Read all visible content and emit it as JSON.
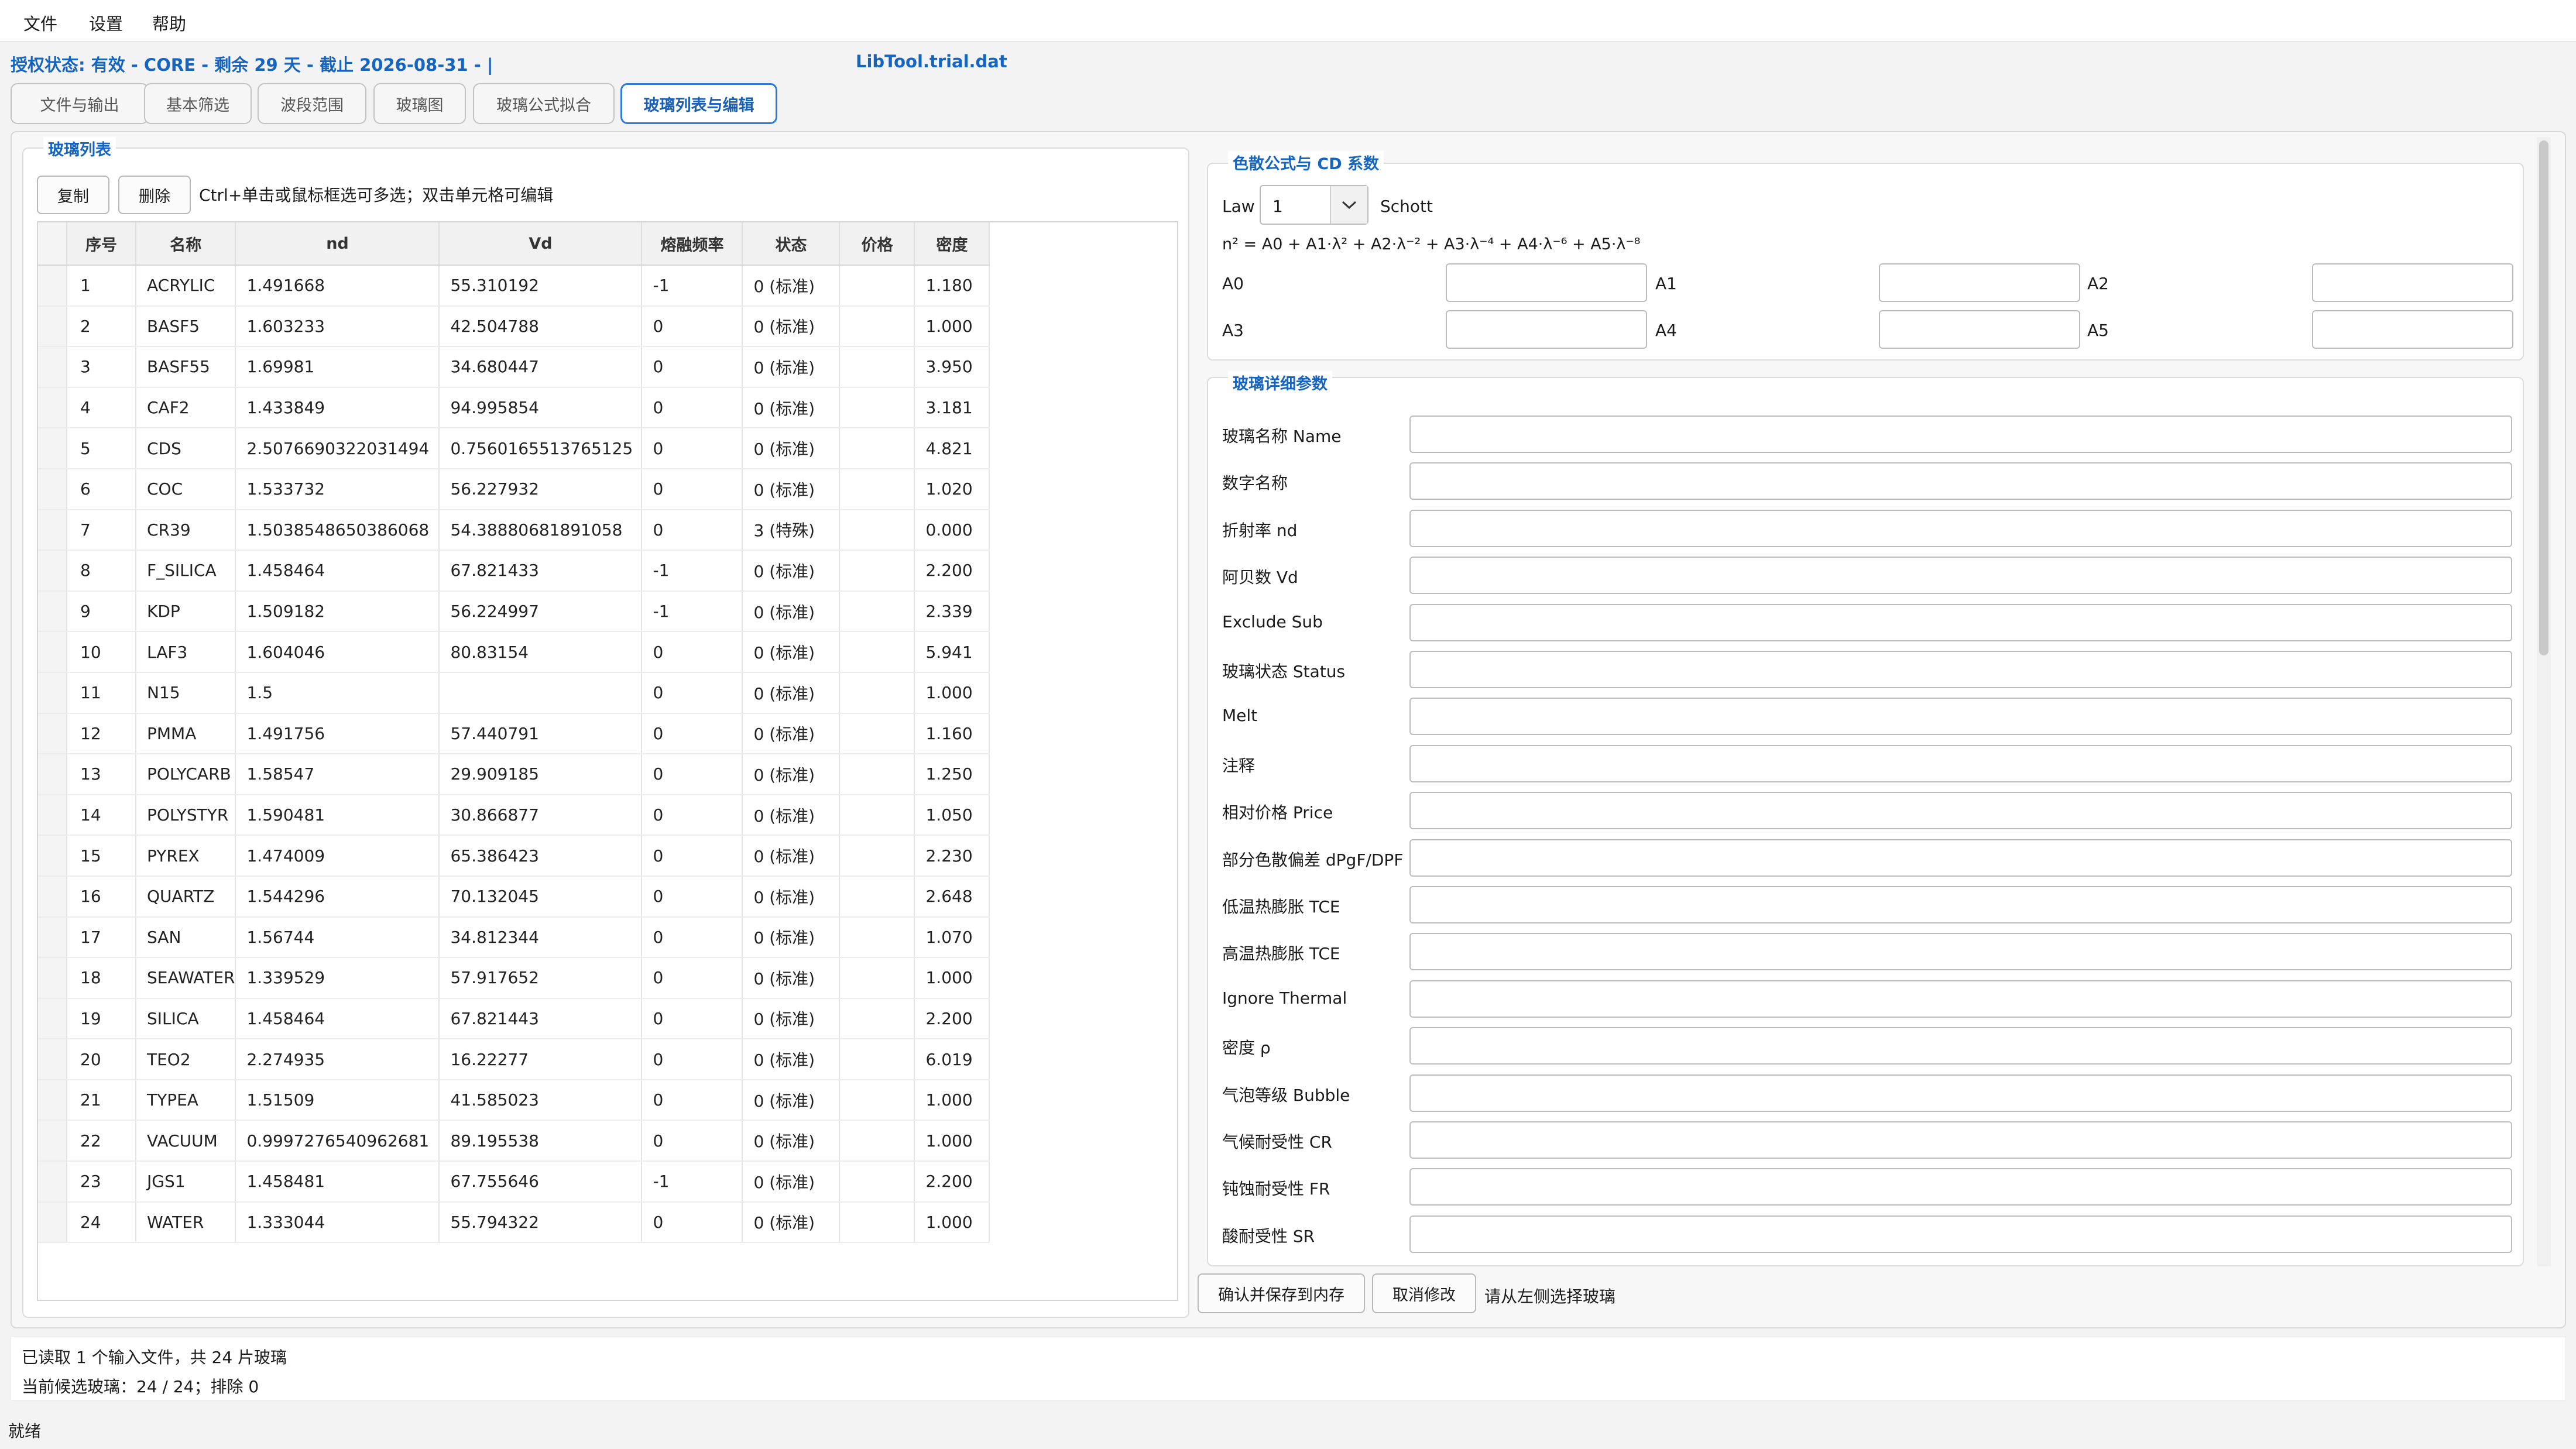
{
  "menu": [
    "文件",
    "设置",
    "帮助"
  ],
  "license_text": "授权状态: 有效 - CORE - 剩余 29 天 - 截止 2026-08-31 - |",
  "filename": "LibTool.trial.dat",
  "tabs": [
    {
      "label": "文件与输出",
      "active": false
    },
    {
      "label": "基本筛选",
      "active": false
    },
    {
      "label": "波段范围",
      "active": false
    },
    {
      "label": "玻璃图",
      "active": false
    },
    {
      "label": "玻璃公式拟合",
      "active": false
    },
    {
      "label": "玻璃列表与编辑",
      "active": true
    }
  ],
  "glass_list": {
    "title": "玻璃列表",
    "copy_label": "复制",
    "delete_label": "删除",
    "hint": "Ctrl+单击或鼠标框选可多选；双击单元格可编辑",
    "sort_indicator": "ˇ",
    "columns": [
      "序号",
      "名称",
      "nd",
      "Vd",
      "熔融频率",
      "状态",
      "价格",
      "密度"
    ],
    "rows": [
      [
        "1",
        "ACRYLIC",
        "1.491668",
        "55.310192",
        "-1",
        "0 (标准)",
        "",
        "1.180"
      ],
      [
        "2",
        "BASF5",
        "1.603233",
        "42.504788",
        "0",
        "0 (标准)",
        "",
        "1.000"
      ],
      [
        "3",
        "BASF55",
        "1.69981",
        "34.680447",
        "0",
        "0 (标准)",
        "",
        "3.950"
      ],
      [
        "4",
        "CAF2",
        "1.433849",
        "94.995854",
        "0",
        "0 (标准)",
        "",
        "3.181"
      ],
      [
        "5",
        "CDS",
        "2.5076690322031494",
        "0.7560165513765125",
        "0",
        "0 (标准)",
        "",
        "4.821"
      ],
      [
        "6",
        "COC",
        "1.533732",
        "56.227932",
        "0",
        "0 (标准)",
        "",
        "1.020"
      ],
      [
        "7",
        "CR39",
        "1.5038548650386068",
        "54.38880681891058",
        "0",
        "3 (特殊)",
        "",
        "0.000"
      ],
      [
        "8",
        "F_SILICA",
        "1.458464",
        "67.821433",
        "-1",
        "0 (标准)",
        "",
        "2.200"
      ],
      [
        "9",
        "KDP",
        "1.509182",
        "56.224997",
        "-1",
        "0 (标准)",
        "",
        "2.339"
      ],
      [
        "10",
        "LAF3",
        "1.604046",
        "80.83154",
        "0",
        "0 (标准)",
        "",
        "5.941"
      ],
      [
        "11",
        "N15",
        "1.5",
        "",
        "0",
        "0 (标准)",
        "",
        "1.000"
      ],
      [
        "12",
        "PMMA",
        "1.491756",
        "57.440791",
        "0",
        "0 (标准)",
        "",
        "1.160"
      ],
      [
        "13",
        "POLYCARB",
        "1.58547",
        "29.909185",
        "0",
        "0 (标准)",
        "",
        "1.250"
      ],
      [
        "14",
        "POLYSTYR",
        "1.590481",
        "30.866877",
        "0",
        "0 (标准)",
        "",
        "1.050"
      ],
      [
        "15",
        "PYREX",
        "1.474009",
        "65.386423",
        "0",
        "0 (标准)",
        "",
        "2.230"
      ],
      [
        "16",
        "QUARTZ",
        "1.544296",
        "70.132045",
        "0",
        "0 (标准)",
        "",
        "2.648"
      ],
      [
        "17",
        "SAN",
        "1.56744",
        "34.812344",
        "0",
        "0 (标准)",
        "",
        "1.070"
      ],
      [
        "18",
        "SEAWATER",
        "1.339529",
        "57.917652",
        "0",
        "0 (标准)",
        "",
        "1.000"
      ],
      [
        "19",
        "SILICA",
        "1.458464",
        "67.821443",
        "0",
        "0 (标准)",
        "",
        "2.200"
      ],
      [
        "20",
        "TEO2",
        "2.274935",
        "16.22277",
        "0",
        "0 (标准)",
        "",
        "6.019"
      ],
      [
        "21",
        "TYPEA",
        "1.51509",
        "41.585023",
        "0",
        "0 (标准)",
        "",
        "1.000"
      ],
      [
        "22",
        "VACUUM",
        "0.9997276540962681",
        "89.195538",
        "0",
        "0 (标准)",
        "",
        "1.000"
      ],
      [
        "23",
        "JGS1",
        "1.458481",
        "67.755646",
        "-1",
        "0 (标准)",
        "",
        "2.200"
      ],
      [
        "24",
        "WATER",
        "1.333044",
        "55.794322",
        "0",
        "0 (标准)",
        "",
        "1.000"
      ]
    ]
  },
  "dispersion": {
    "title": "色散公式与 CD 系数",
    "law_label": "Law",
    "law_value": "1",
    "law_name": "Schott",
    "formula": "n² = A0 + A1·λ² + A2·λ⁻² + A3·λ⁻⁴ + A4·λ⁻⁶ + A5·λ⁻⁸",
    "coef_labels": [
      "A0",
      "A1",
      "A2",
      "A3",
      "A4",
      "A5"
    ]
  },
  "details": {
    "title": "玻璃详细参数",
    "fields": [
      "玻璃名称 Name",
      "数字名称",
      "折射率 nd",
      "阿贝数 Vd",
      "Exclude Sub",
      "玻璃状态 Status",
      "Melt",
      "注释",
      "相对价格 Price",
      "部分色散偏差 dPgF/DPF",
      "低温热膨胀 TCE",
      "高温热膨胀 TCE",
      "Ignore Thermal",
      "密度 ρ",
      "气泡等级 Bubble",
      "气候耐受性 CR",
      "钝蚀耐受性 FR",
      "酸耐受性 SR"
    ]
  },
  "actions": {
    "save_label": "确认并保存到内存",
    "cancel_label": "取消修改",
    "hint": "请从左侧选择玻璃"
  },
  "status": {
    "line1": "已读取 1 个输入文件，共 24 片玻璃",
    "line2": "当前候选玻璃：24 / 24；排除 0",
    "ready": "就绪"
  },
  "colors": {
    "accent": "#1565c0",
    "active_tab_border": "#2f7bd8"
  }
}
